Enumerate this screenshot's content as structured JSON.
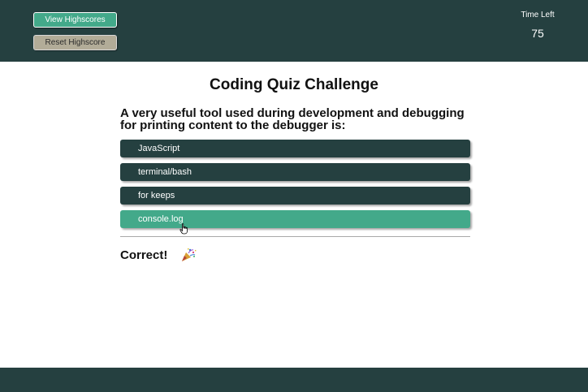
{
  "header": {
    "view_highscores_label": "View Highscores",
    "reset_highscore_label": "Reset Highscore",
    "timer_label": "Time Left",
    "timer_value": "75"
  },
  "quiz": {
    "title": "Coding Quiz Challenge",
    "question": "A very useful tool used during development and debugging for printing content to the debugger is:",
    "answers": [
      {
        "label": "JavaScript",
        "selected": false
      },
      {
        "label": "terminal/bash",
        "selected": false
      },
      {
        "label": "for keeps",
        "selected": false
      },
      {
        "label": "console.log",
        "selected": true
      }
    ],
    "result": "Correct!",
    "result_icon": "party-popper-icon"
  },
  "colors": {
    "header_bg": "#254040",
    "accent_green": "#43a98a",
    "reset_button_bg": "#b2ac98"
  }
}
